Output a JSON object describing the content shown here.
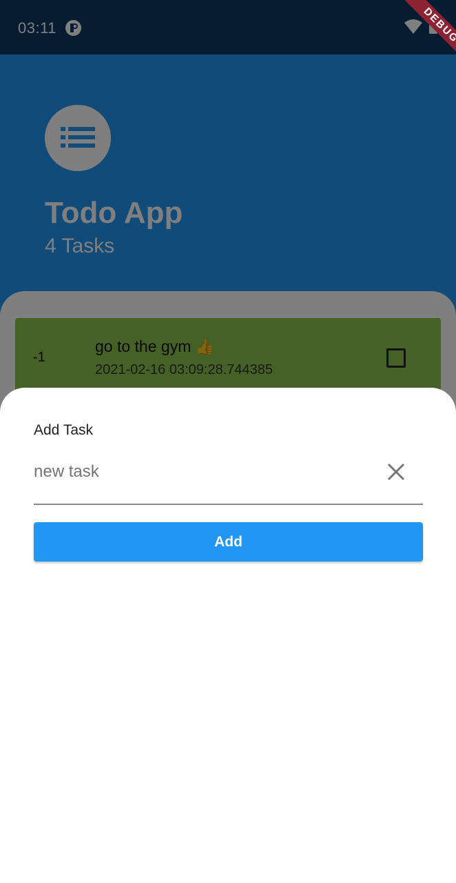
{
  "status_bar": {
    "time": "03:11",
    "debug_label": "DEBUG",
    "icons": [
      "app-notification-icon",
      "wifi-icon",
      "battery-icon"
    ]
  },
  "header": {
    "icon": "list-icon",
    "title": "Todo App",
    "task_count": "4 Tasks"
  },
  "tasks": [
    {
      "index": "-1",
      "title": "go to the gym",
      "emoji": "👍",
      "date": "2021-02-16 03:09:28.744385",
      "checked": false
    }
  ],
  "sheet": {
    "title": "Add Task",
    "input_placeholder": "new task",
    "input_value": "",
    "clear_icon": "close-icon",
    "add_label": "Add"
  },
  "colors": {
    "primary": "#2196f3",
    "status_bar": "#0d3a63",
    "task_card": "#8bc34a",
    "debug_banner": "#8c2232",
    "scrim": "rgba(0,0,0,0.5)"
  }
}
